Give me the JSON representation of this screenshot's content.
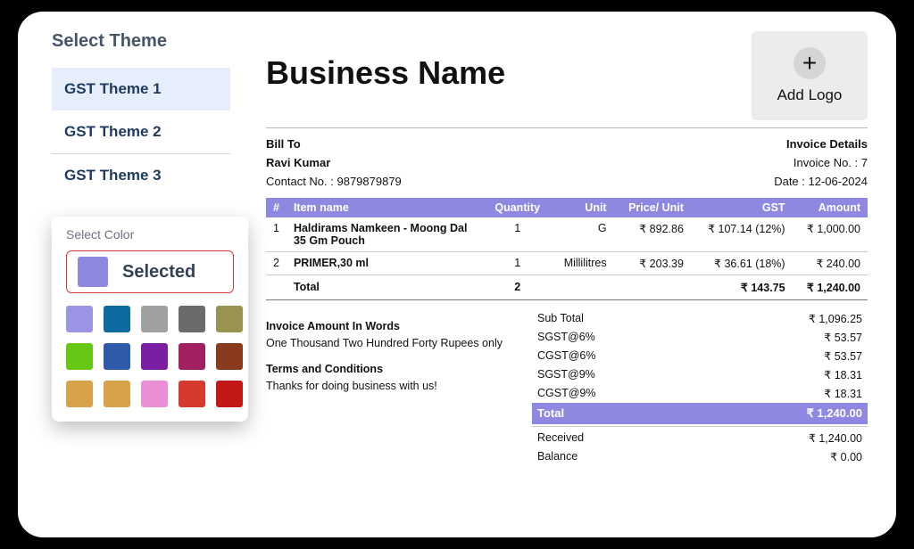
{
  "accent_color": "#8f88e1",
  "sidebar": {
    "title": "Select Theme",
    "themes": [
      "GST Theme 1",
      "GST Theme 2",
      "GST Theme 3"
    ],
    "active_index": 0
  },
  "color_panel": {
    "title": "Select Color",
    "selected_label": "Selected",
    "selected_color": "#8f88e1",
    "swatches": [
      "#9a93e6",
      "#0e6aa0",
      "#a0a0a0",
      "#6b6b6b",
      "#98944f",
      "#67c716",
      "#2e5aa8",
      "#7b1fa2",
      "#a12060",
      "#8a3a1f",
      "#d7a24a",
      "#d7a24a",
      "#ea8fd6",
      "#d63a2f",
      "#c41818"
    ]
  },
  "invoice": {
    "business_name": "Business Name",
    "add_logo_label": "Add Logo",
    "bill_to_label": "Bill To",
    "invoice_details_label": "Invoice Details",
    "customer_name": "Ravi Kumar",
    "contact_label": "Contact No. : 9879879879",
    "invoice_no_label": "Invoice No. : 7",
    "date_label": "Date : 12-06-2024",
    "table": {
      "headers": [
        "#",
        "Item name",
        "Quantity",
        "Unit",
        "Price/ Unit",
        "GST",
        "Amount"
      ],
      "rows": [
        {
          "n": "1",
          "name": "Haldirams Namkeen - Moong Dal 35 Gm Pouch",
          "qty": "1",
          "unit": "G",
          "price": "₹ 892.86",
          "gst": "₹ 107.14 (12%)",
          "amount": "₹ 1,000.00"
        },
        {
          "n": "2",
          "name": "PRIMER,30 ml",
          "qty": "1",
          "unit": "Millilitres",
          "price": "₹ 203.39",
          "gst": "₹ 36.61 (18%)",
          "amount": "₹ 240.00"
        }
      ],
      "total_label": "Total",
      "total_qty": "2",
      "total_gst": "₹ 143.75",
      "total_amount": "₹ 1,240.00"
    },
    "amount_words_label": "Invoice Amount In Words",
    "amount_words": "One Thousand Two Hundred Forty Rupees only",
    "terms_label": "Terms and Conditions",
    "terms_text": "Thanks for doing business with us!",
    "summary": [
      {
        "label": "Sub Total",
        "value": "₹ 1,096.25"
      },
      {
        "label": "SGST@6%",
        "value": "₹ 53.57"
      },
      {
        "label": "CGST@6%",
        "value": "₹ 53.57"
      },
      {
        "label": "SGST@9%",
        "value": "₹ 18.31"
      },
      {
        "label": "CGST@9%",
        "value": "₹ 18.31"
      }
    ],
    "summary_total": {
      "label": "Total",
      "value": "₹ 1,240.00"
    },
    "summary_after": [
      {
        "label": "Received",
        "value": "₹ 1,240.00"
      },
      {
        "label": "Balance",
        "value": "₹ 0.00"
      }
    ]
  }
}
